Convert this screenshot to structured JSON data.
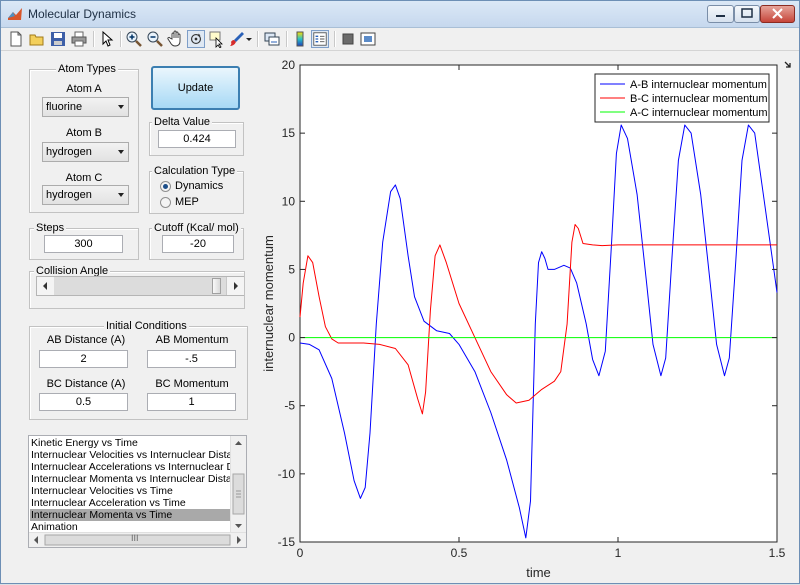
{
  "window": {
    "title": "Molecular Dynamics"
  },
  "toolbar": {
    "buttons": [
      "new-file-icon",
      "open-folder-icon",
      "save-icon",
      "print-icon",
      "pointer-icon",
      "zoom-in-icon",
      "zoom-out-icon",
      "pan-hand-icon",
      "rotate-3d-icon",
      "data-cursor-icon",
      "brush-icon",
      "link-plot-icon",
      "colorbar-icon",
      "legend-icon",
      "hide-plot-tools-icon",
      "show-plot-tools-icon"
    ]
  },
  "atom_types": {
    "title": "Atom Types",
    "atom_a_label": "Atom A",
    "atom_a_value": "fluorine",
    "atom_b_label": "Atom B",
    "atom_b_value": "hydrogen",
    "atom_c_label": "Atom C",
    "atom_c_value": "hydrogen"
  },
  "update_button": "Update",
  "delta": {
    "title": "Delta Value",
    "value": "0.424"
  },
  "calc_type": {
    "title": "Calculation Type",
    "options": [
      "Dynamics",
      "MEP"
    ],
    "selected": "Dynamics"
  },
  "steps": {
    "title": "Steps",
    "value": "300"
  },
  "cutoff": {
    "title": "Cutoff (Kcal/ mol)",
    "value": "-20"
  },
  "collision_angle": {
    "title": "Collision Angle",
    "slider_fraction": 0.97
  },
  "initial_conditions": {
    "title": "Initial Conditions",
    "ab_distance_label": "AB Distance (A)",
    "ab_distance_value": "2",
    "ab_momentum_label": "AB Momentum",
    "ab_momentum_value": "-.5",
    "bc_distance_label": "BC Distance (A)",
    "bc_distance_value": "0.5",
    "bc_momentum_label": "BC Momentum",
    "bc_momentum_value": "1"
  },
  "plot_list": {
    "items": [
      "Kinetic Energy vs Time",
      "Internuclear Velocities vs Internuclear Distance",
      "Internuclear Accelerations vs Internuclear Distance",
      "Internuclear Momenta vs Internuclear Distance",
      "Internuclear Velocities vs Time",
      "Internuclear Acceleration vs Time",
      "Internuclear Momenta vs Time",
      "Animation"
    ],
    "selected_index": 6,
    "hscroll_grip": "III"
  },
  "chart_data": {
    "type": "line",
    "xlabel": "time",
    "ylabel": "internuclear momentum",
    "xlim": [
      0,
      1.5
    ],
    "ylim": [
      -15,
      20
    ],
    "xticks": [
      "0",
      "0.5",
      "1",
      "1.5"
    ],
    "yticks": [
      "-15",
      "-10",
      "-5",
      "0",
      "5",
      "10",
      "15",
      "20"
    ],
    "legend_position": "top-right",
    "series": [
      {
        "name": "A-B internuclear momentum",
        "color": "#0000ff",
        "points": [
          [
            0,
            -0.4
          ],
          [
            0.03,
            -0.5
          ],
          [
            0.06,
            -0.9
          ],
          [
            0.1,
            -3
          ],
          [
            0.14,
            -7
          ],
          [
            0.17,
            -10.5
          ],
          [
            0.19,
            -11.8
          ],
          [
            0.205,
            -11
          ],
          [
            0.22,
            -7
          ],
          [
            0.24,
            1
          ],
          [
            0.26,
            7
          ],
          [
            0.285,
            10.7
          ],
          [
            0.3,
            11.2
          ],
          [
            0.315,
            10.2
          ],
          [
            0.34,
            6
          ],
          [
            0.36,
            3
          ],
          [
            0.39,
            1.2
          ],
          [
            0.43,
            0.5
          ],
          [
            0.47,
            0.3
          ],
          [
            0.5,
            -0.5
          ],
          [
            0.55,
            -2.5
          ],
          [
            0.6,
            -5.5
          ],
          [
            0.65,
            -9
          ],
          [
            0.69,
            -12.5
          ],
          [
            0.71,
            -14.7
          ],
          [
            0.725,
            -12
          ],
          [
            0.74,
            1
          ],
          [
            0.75,
            5.5
          ],
          [
            0.76,
            6.3
          ],
          [
            0.77,
            5.8
          ],
          [
            0.78,
            5
          ],
          [
            0.8,
            5
          ],
          [
            0.83,
            5.3
          ],
          [
            0.85,
            5.1
          ],
          [
            0.87,
            4
          ],
          [
            0.9,
            1
          ],
          [
            0.92,
            -1.6
          ],
          [
            0.94,
            -2.8
          ],
          [
            0.96,
            -1
          ],
          [
            0.98,
            7
          ],
          [
            0.995,
            13.5
          ],
          [
            1.01,
            15.6
          ],
          [
            1.03,
            14.6
          ],
          [
            1.06,
            10.5
          ],
          [
            1.09,
            4
          ],
          [
            1.11,
            -0.5
          ],
          [
            1.135,
            -2.8
          ],
          [
            1.15,
            -1.5
          ],
          [
            1.17,
            6
          ],
          [
            1.19,
            13
          ],
          [
            1.21,
            15.6
          ],
          [
            1.23,
            15
          ],
          [
            1.26,
            10.5
          ],
          [
            1.29,
            4
          ],
          [
            1.31,
            -0.5
          ],
          [
            1.335,
            -2.8
          ],
          [
            1.35,
            -1.5
          ],
          [
            1.37,
            5.5
          ],
          [
            1.39,
            13
          ],
          [
            1.41,
            15.6
          ],
          [
            1.43,
            15
          ],
          [
            1.46,
            10
          ],
          [
            1.49,
            5
          ],
          [
            1.5,
            3.3
          ]
        ]
      },
      {
        "name": "B-C internuclear momentum",
        "color": "#ff0000",
        "points": [
          [
            0,
            1.5
          ],
          [
            0.01,
            4
          ],
          [
            0.025,
            6
          ],
          [
            0.04,
            5.5
          ],
          [
            0.06,
            3
          ],
          [
            0.08,
            0.8
          ],
          [
            0.1,
            -0.1
          ],
          [
            0.12,
            -0.4
          ],
          [
            0.15,
            -0.4
          ],
          [
            0.2,
            -0.4
          ],
          [
            0.25,
            -0.5
          ],
          [
            0.3,
            -0.8
          ],
          [
            0.34,
            -2
          ],
          [
            0.37,
            -4.5
          ],
          [
            0.385,
            -5.6
          ],
          [
            0.395,
            -4
          ],
          [
            0.41,
            2
          ],
          [
            0.425,
            6
          ],
          [
            0.44,
            6.8
          ],
          [
            0.46,
            5.5
          ],
          [
            0.5,
            2.5
          ],
          [
            0.55,
            0
          ],
          [
            0.6,
            -2.5
          ],
          [
            0.65,
            -4.2
          ],
          [
            0.68,
            -4.8
          ],
          [
            0.72,
            -4.6
          ],
          [
            0.76,
            -3.8
          ],
          [
            0.8,
            -3.2
          ],
          [
            0.82,
            -2.5
          ],
          [
            0.84,
            1
          ],
          [
            0.855,
            7
          ],
          [
            0.865,
            8.3
          ],
          [
            0.875,
            8
          ],
          [
            0.89,
            6.9
          ],
          [
            0.92,
            6.8
          ],
          [
            0.95,
            6.75
          ],
          [
            1.0,
            6.8
          ],
          [
            1.1,
            6.8
          ],
          [
            1.2,
            6.8
          ],
          [
            1.3,
            6.8
          ],
          [
            1.4,
            6.8
          ],
          [
            1.5,
            6.8
          ]
        ]
      },
      {
        "name": "A-C internuclear momentum",
        "color": "#00ff00",
        "points": [
          [
            0,
            0
          ],
          [
            1.5,
            0
          ]
        ]
      }
    ]
  }
}
